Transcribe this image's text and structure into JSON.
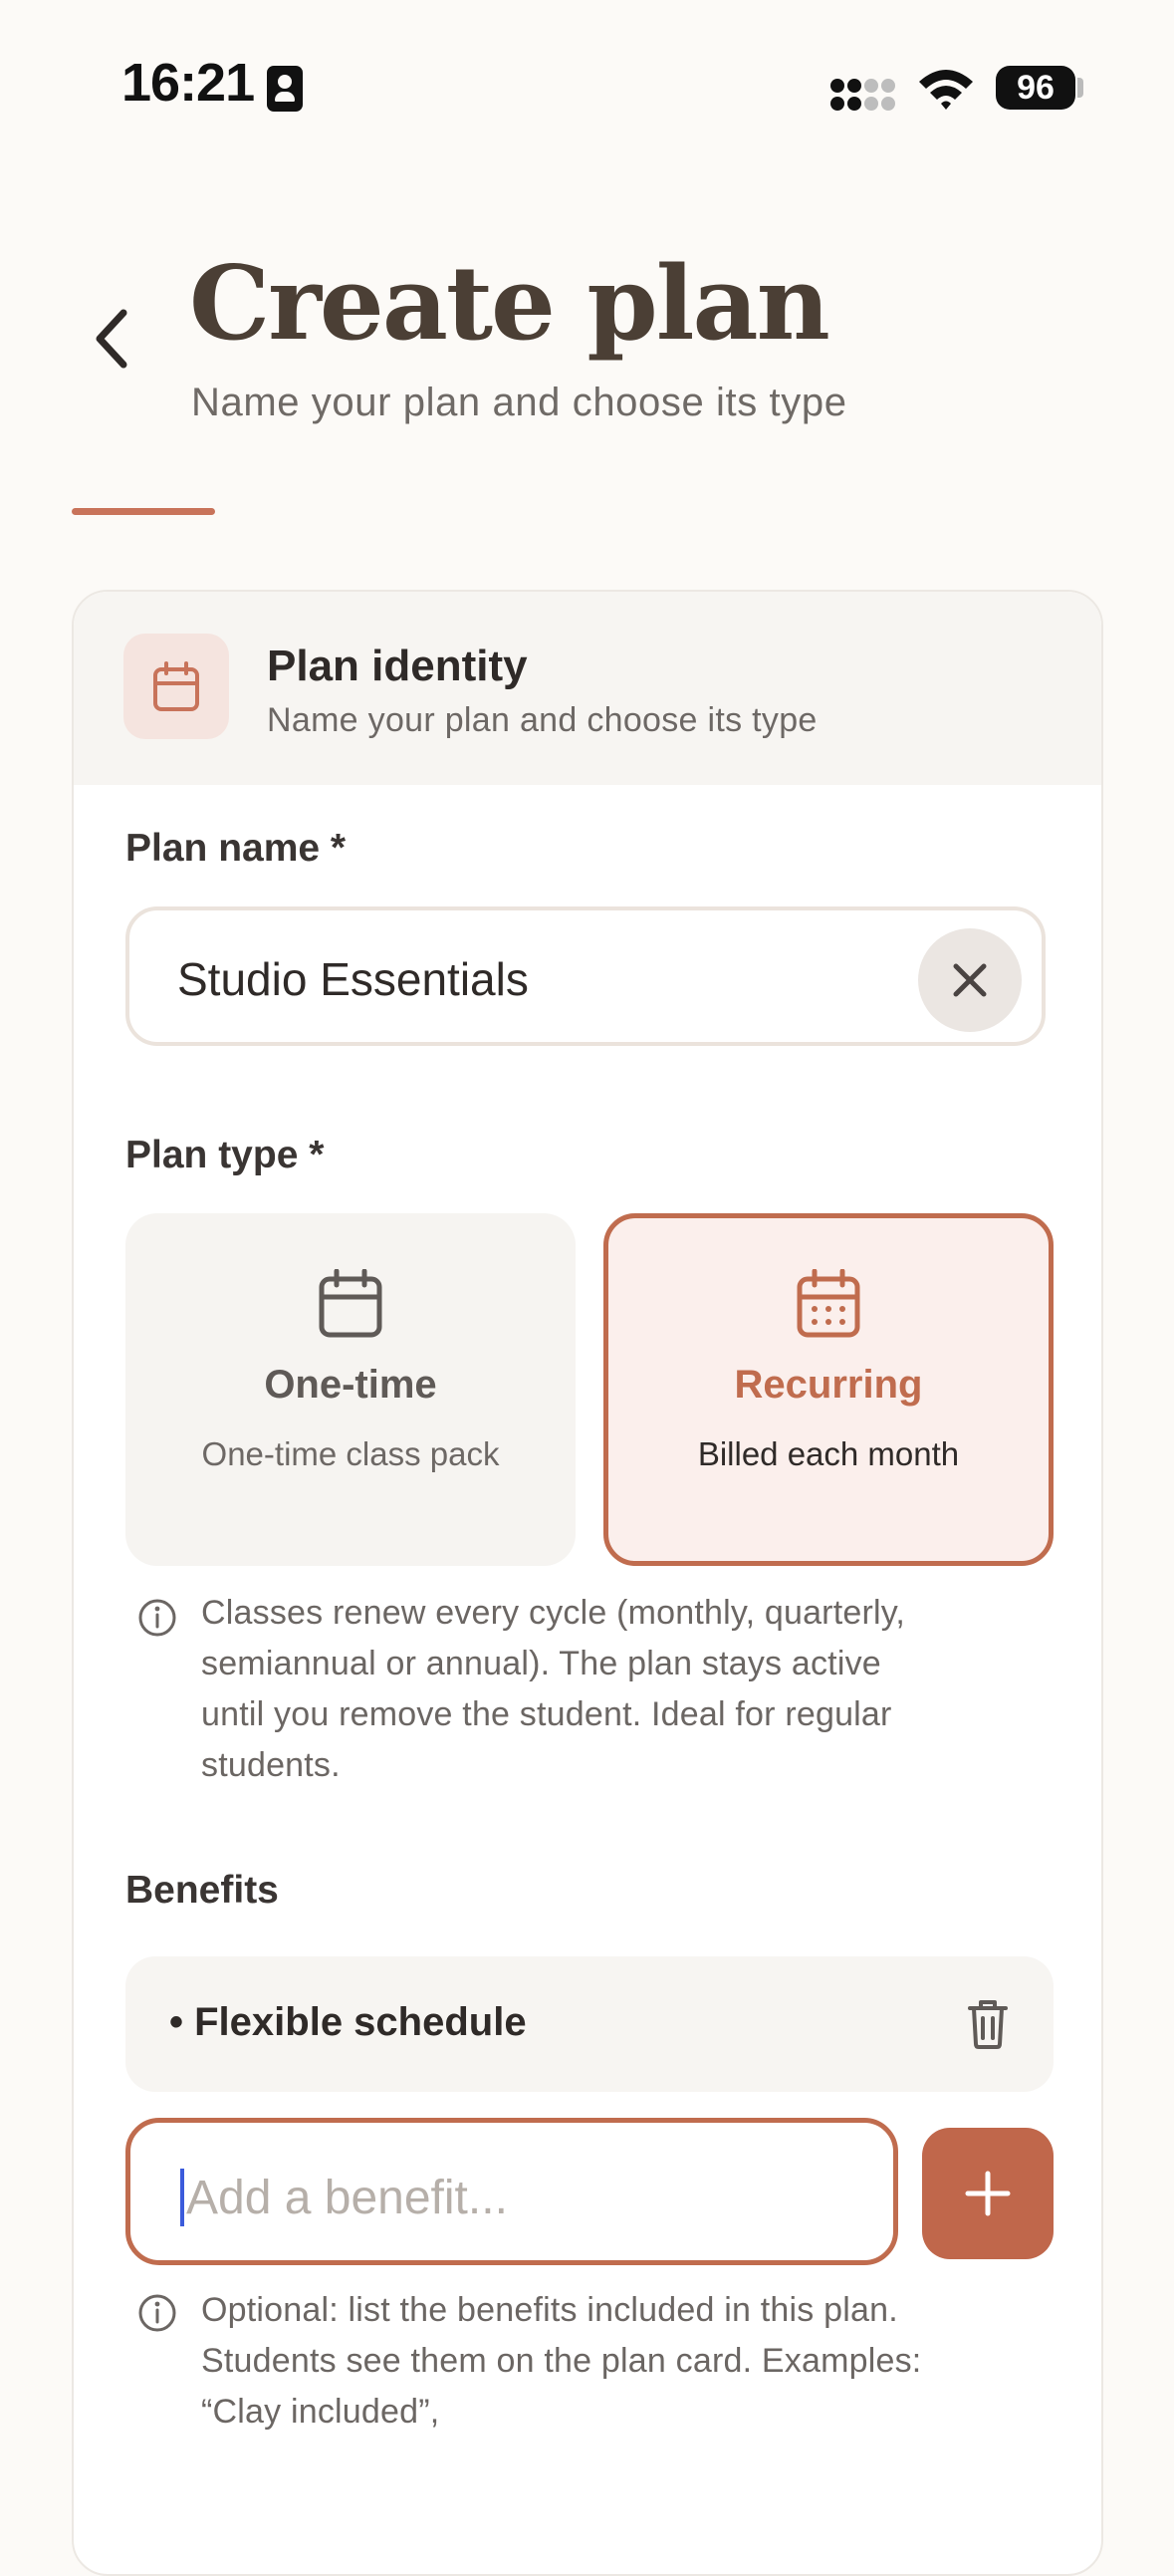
{
  "status": {
    "time": "16:21",
    "battery": "96"
  },
  "header": {
    "title": "Create plan",
    "subtitle": "Name your plan and choose its type"
  },
  "section": {
    "title": "Plan identity",
    "subtitle": "Name your plan and choose its type"
  },
  "plan_name": {
    "label": "Plan name *",
    "value": "Studio Essentials"
  },
  "plan_type": {
    "label": "Plan type *",
    "options": [
      {
        "name": "One-time",
        "desc": "One-time class pack",
        "selected": false
      },
      {
        "name": "Recurring",
        "desc": "Billed each month",
        "selected": true
      }
    ],
    "info_lines": [
      "Classes renew every cycle (monthly, quarterly,",
      "semiannual or annual). The plan stays active",
      "until you remove the student. Ideal for regular",
      "students."
    ]
  },
  "benefits": {
    "label": "Benefits",
    "items": [
      "• Flexible schedule"
    ],
    "placeholder": "Add a benefit...",
    "info_lines": [
      "Optional: list the benefits included in this plan.",
      "Students see them on the plan card. Examples:",
      "“Clay included”,"
    ]
  },
  "colors": {
    "accent": "#c0674b",
    "background": "#fcfaf7",
    "title": "#4b3f35"
  }
}
